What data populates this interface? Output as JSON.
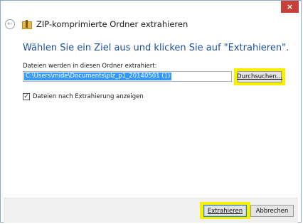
{
  "window": {
    "close_glyph": "×",
    "title": "ZIP-komprimierte Ordner extrahieren",
    "back_glyph": "←"
  },
  "content": {
    "heading": "Wählen Sie ein Ziel aus und klicken Sie auf \"Extrahieren\".",
    "folder_label": "Dateien werden in diesen Ordner extrahiert:",
    "path_value": "C:\\Users\\mide\\Documents\\plz_p1_20140501 (1)",
    "browse_label": "Durchsuchen...",
    "checkbox_checked": true,
    "checkbox_glyph": "✓",
    "checkbox_label": "Dateien nach Extrahierung anzeigen"
  },
  "footer": {
    "extract_label": "Extrahieren",
    "cancel_label": "Abbrechen"
  },
  "colors": {
    "heading": "#1c4fa0",
    "highlight": "#f6f000",
    "close": "#c7413a",
    "selection": "#3399ff"
  },
  "icons": {
    "back": "arrow-left-icon",
    "title": "zip-folder-icon",
    "close": "close-icon",
    "checkbox": "checkmark-icon"
  }
}
